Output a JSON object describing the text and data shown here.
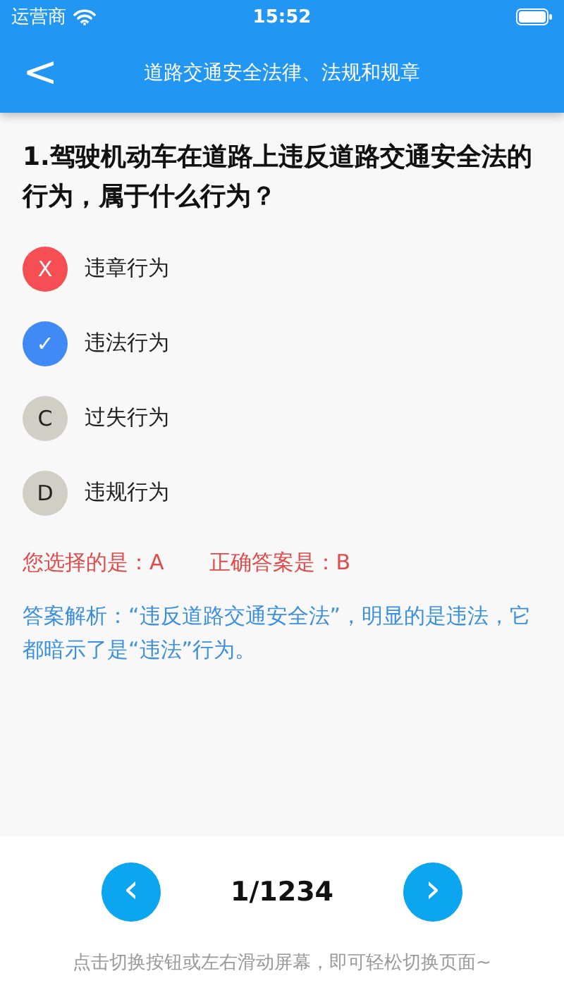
{
  "status_bar": {
    "carrier": "运营商",
    "time": "15:52"
  },
  "nav": {
    "back": "<",
    "title": "道路交通安全法律、法规和规章"
  },
  "question": {
    "text": "1.驾驶机动车在道路上违反道路交通安全法的行为，属于什么行为？"
  },
  "options": [
    {
      "mark": "X",
      "label": "违章行为",
      "kind": "wrong"
    },
    {
      "mark": "✓",
      "label": "违法行为",
      "kind": "correct"
    },
    {
      "mark": "C",
      "label": "过失行为",
      "kind": "plain"
    },
    {
      "mark": "D",
      "label": "违规行为",
      "kind": "plain"
    }
  ],
  "result": {
    "chosen": "您选择的是：A",
    "correct": "正确答案是：B"
  },
  "analysis": "答案解析：“违反道路交通安全法”，明显的是违法，它都暗示了是“违法”行为。",
  "pager": {
    "prev": "‹",
    "counter": "1/1234",
    "next": "›"
  },
  "hint": "点击切换按钮或左右滑动屏幕，即可轻松切换页面~"
}
